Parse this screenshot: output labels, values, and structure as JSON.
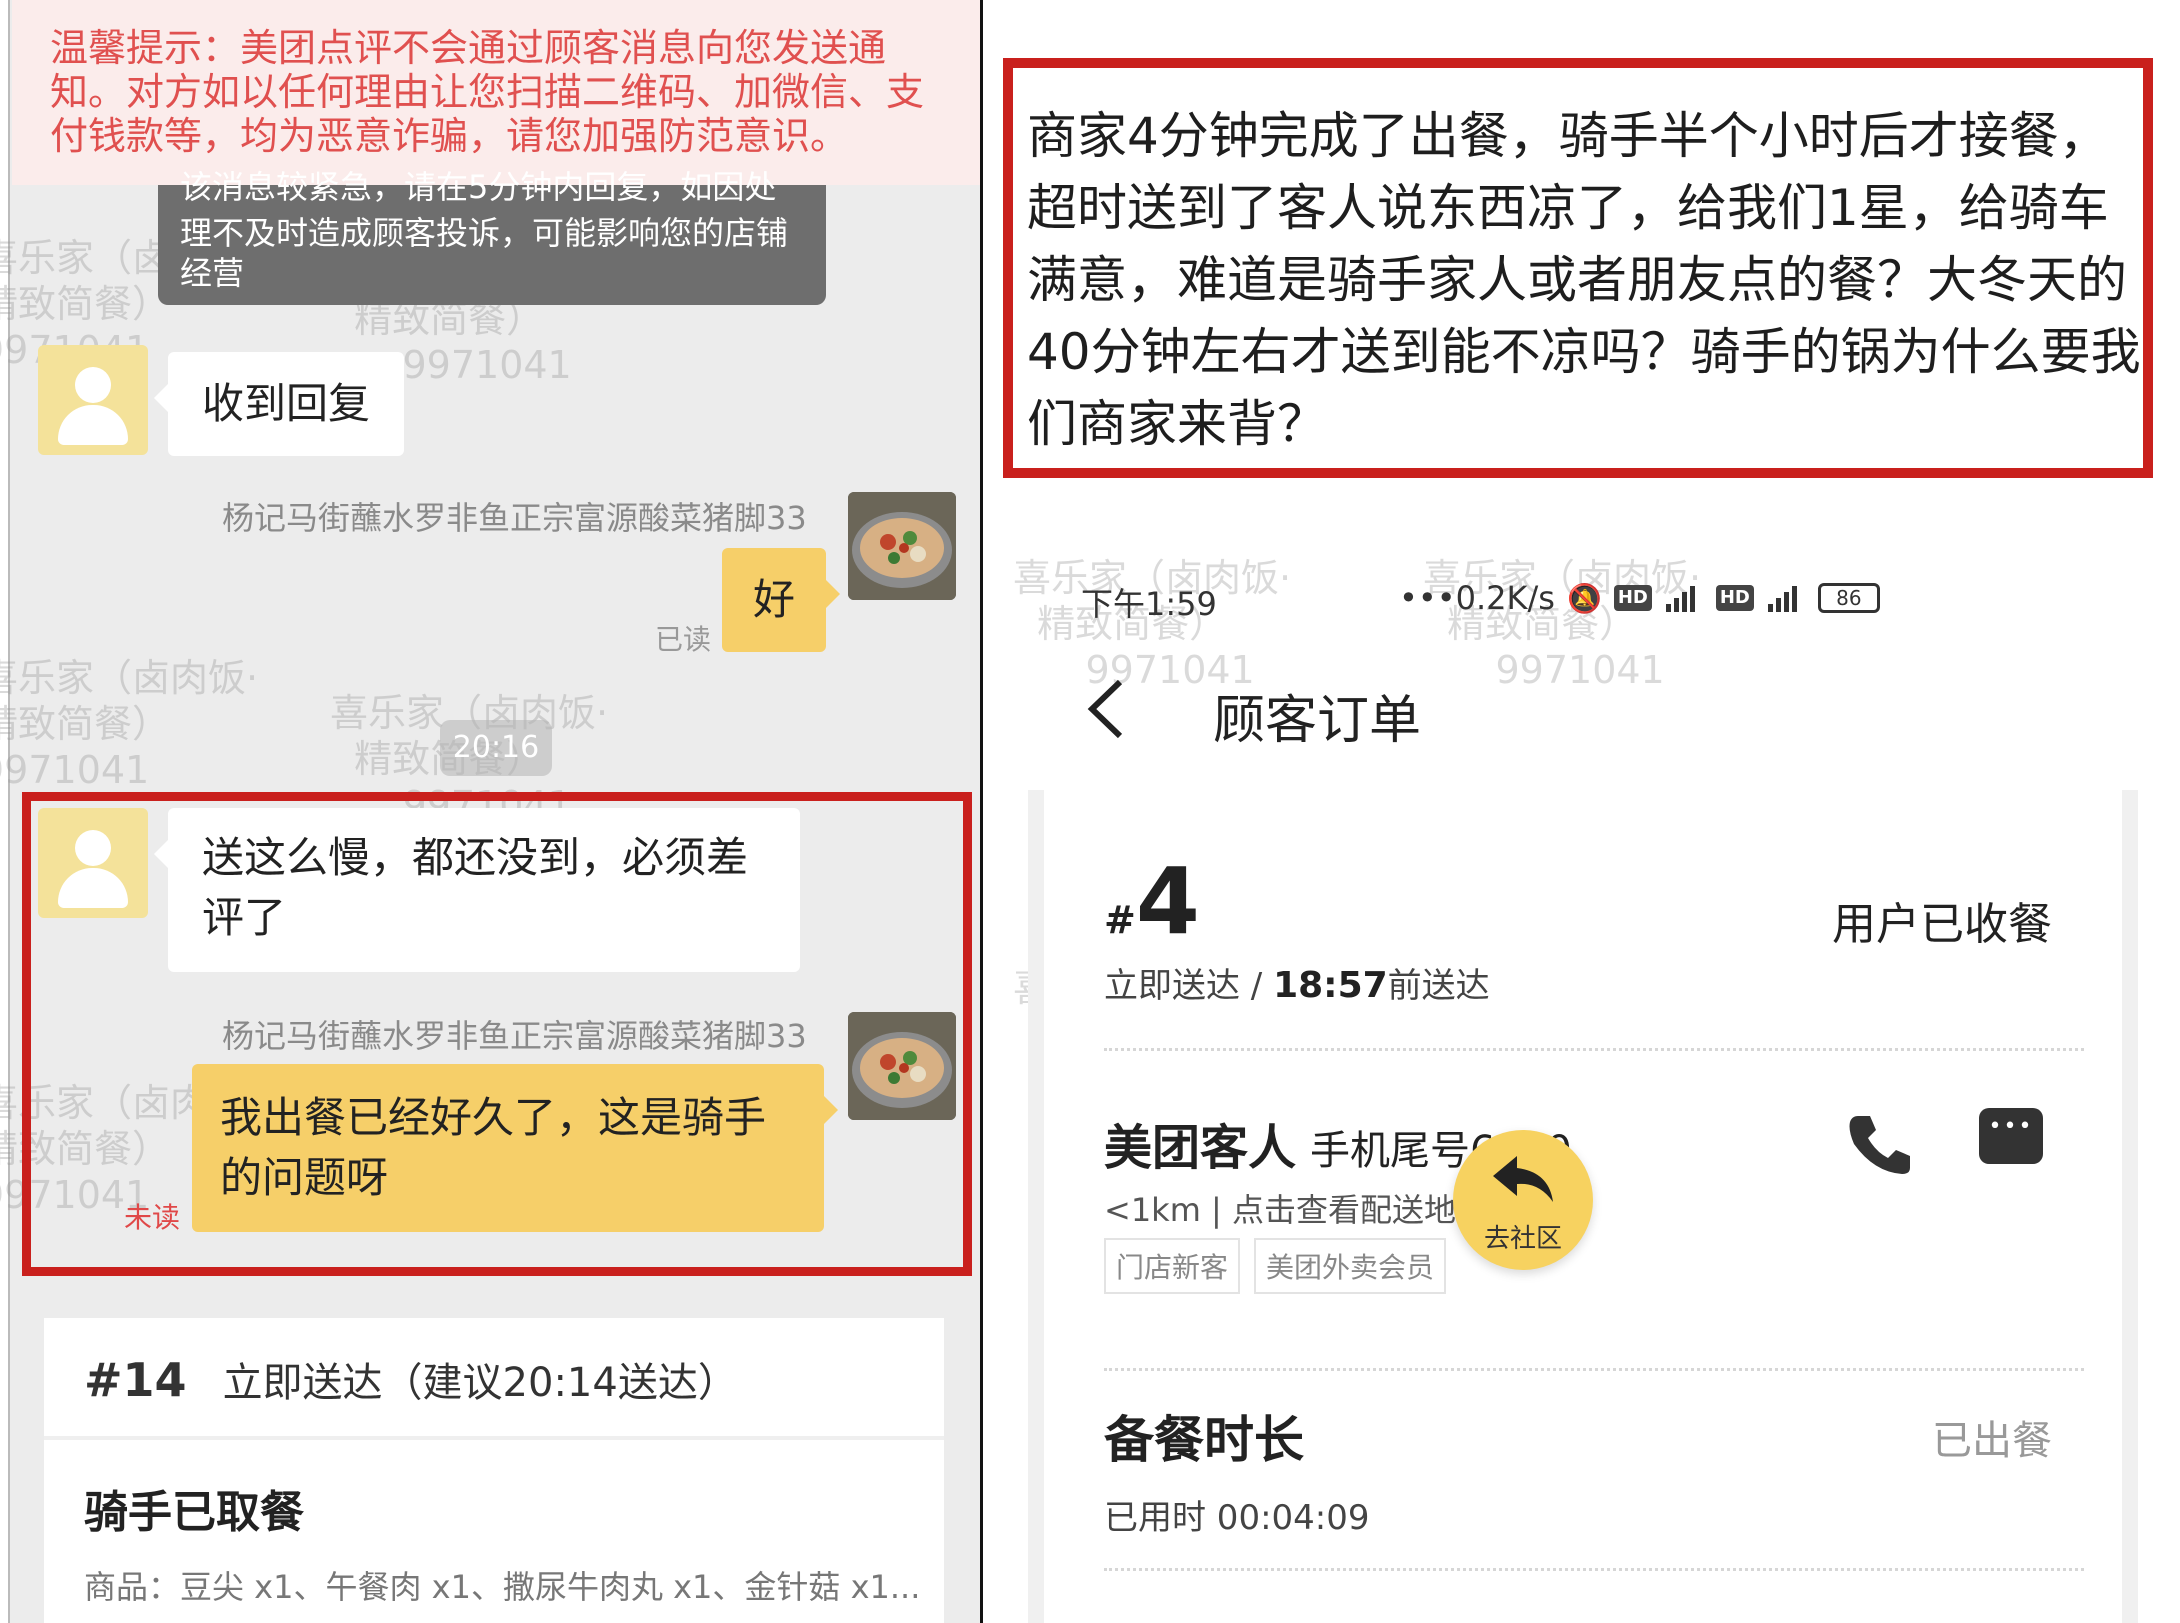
{
  "left_chat": {
    "warning": "温馨提示：美团点评不会通过顾客消息向您发送通知。对方如以任何理由让您扫描二维码、加微信、支付钱款等，均为恶意诈骗，请您加强防范意识。",
    "tip_partial_line1": "该消息较紧急，请在5分钟内回复，如因处",
    "tip_line2": "理不及时造成顾客投诉，可能影响您的店铺",
    "tip_line3": "经营",
    "msg1": "收到回复",
    "shop_name": "杨记马街蘸水罗非鱼正宗富源酸菜猪脚33",
    "reply1": "好",
    "read_label": "已读",
    "time_label": "20:16",
    "msg2": "送这么慢，都还没到，必须差评了",
    "reply2": "我出餐已经好久了，这是骑手的问题呀",
    "unread_label": "未读",
    "order": {
      "number": "#14",
      "delivery": "立即送达（建议20:14送达）",
      "status": "骑手已取餐",
      "items": "商品：豆尖 x1、午餐肉 x1、撒尿牛肉丸 x1、金针菇 x1..."
    }
  },
  "watermark": {
    "line1": "喜乐家（卤肉饭·",
    "line2": "精致简餐）",
    "line3": "9971041"
  },
  "right": {
    "complaint": "商家4分钟完成了出餐，骑手半个小时后才接餐，超时送到了客人说东西凉了，给我们1星，给骑车满意，难道是骑手家人或者朋友点的餐？大冬天的40分钟左右才送到能不凉吗？骑手的锅为什么要我们商家来背？",
    "status_bar": {
      "time": "下午1:59",
      "speed": "0.2K/s",
      "hd1": "HD",
      "hd2": "HD",
      "battery": "86"
    },
    "nav_title": "顾客订单",
    "order": {
      "hash_symbol": "#",
      "number": "4",
      "status": "用户已收餐",
      "delivery_prefix": "立即送达 / ",
      "delivery_time": "18:57",
      "delivery_suffix": "前送达",
      "customer": "美团客人",
      "phone_tail": "手机尾号6570",
      "distance": "<1km | 点击查看配送地址 >",
      "tags": [
        "门店新客",
        "美团外卖会员"
      ],
      "prep_title": "备餐时长",
      "prep_status": "已出餐",
      "elapsed": "已用时 00:04:09"
    },
    "community_button": "去社区"
  }
}
